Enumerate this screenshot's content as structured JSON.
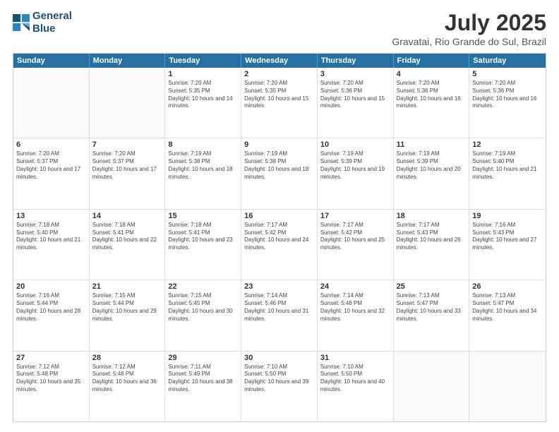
{
  "header": {
    "logo_line1": "General",
    "logo_line2": "Blue",
    "month_year": "July 2025",
    "location": "Gravatai, Rio Grande do Sul, Brazil"
  },
  "weekdays": [
    "Sunday",
    "Monday",
    "Tuesday",
    "Wednesday",
    "Thursday",
    "Friday",
    "Saturday"
  ],
  "weeks": [
    [
      {
        "day": "",
        "sunrise": "",
        "sunset": "",
        "daylight": ""
      },
      {
        "day": "",
        "sunrise": "",
        "sunset": "",
        "daylight": ""
      },
      {
        "day": "1",
        "sunrise": "Sunrise: 7:20 AM",
        "sunset": "Sunset: 5:35 PM",
        "daylight": "Daylight: 10 hours and 14 minutes."
      },
      {
        "day": "2",
        "sunrise": "Sunrise: 7:20 AM",
        "sunset": "Sunset: 5:35 PM",
        "daylight": "Daylight: 10 hours and 15 minutes."
      },
      {
        "day": "3",
        "sunrise": "Sunrise: 7:20 AM",
        "sunset": "Sunset: 5:36 PM",
        "daylight": "Daylight: 10 hours and 15 minutes."
      },
      {
        "day": "4",
        "sunrise": "Sunrise: 7:20 AM",
        "sunset": "Sunset: 5:36 PM",
        "daylight": "Daylight: 10 hours and 16 minutes."
      },
      {
        "day": "5",
        "sunrise": "Sunrise: 7:20 AM",
        "sunset": "Sunset: 5:36 PM",
        "daylight": "Daylight: 10 hours and 16 minutes."
      }
    ],
    [
      {
        "day": "6",
        "sunrise": "Sunrise: 7:20 AM",
        "sunset": "Sunset: 5:37 PM",
        "daylight": "Daylight: 10 hours and 17 minutes."
      },
      {
        "day": "7",
        "sunrise": "Sunrise: 7:20 AM",
        "sunset": "Sunset: 5:37 PM",
        "daylight": "Daylight: 10 hours and 17 minutes."
      },
      {
        "day": "8",
        "sunrise": "Sunrise: 7:19 AM",
        "sunset": "Sunset: 5:38 PM",
        "daylight": "Daylight: 10 hours and 18 minutes."
      },
      {
        "day": "9",
        "sunrise": "Sunrise: 7:19 AM",
        "sunset": "Sunset: 5:38 PM",
        "daylight": "Daylight: 10 hours and 18 minutes."
      },
      {
        "day": "10",
        "sunrise": "Sunrise: 7:19 AM",
        "sunset": "Sunset: 5:39 PM",
        "daylight": "Daylight: 10 hours and 19 minutes."
      },
      {
        "day": "11",
        "sunrise": "Sunrise: 7:19 AM",
        "sunset": "Sunset: 5:39 PM",
        "daylight": "Daylight: 10 hours and 20 minutes."
      },
      {
        "day": "12",
        "sunrise": "Sunrise: 7:19 AM",
        "sunset": "Sunset: 5:40 PM",
        "daylight": "Daylight: 10 hours and 21 minutes."
      }
    ],
    [
      {
        "day": "13",
        "sunrise": "Sunrise: 7:18 AM",
        "sunset": "Sunset: 5:40 PM",
        "daylight": "Daylight: 10 hours and 21 minutes."
      },
      {
        "day": "14",
        "sunrise": "Sunrise: 7:18 AM",
        "sunset": "Sunset: 5:41 PM",
        "daylight": "Daylight: 10 hours and 22 minutes."
      },
      {
        "day": "15",
        "sunrise": "Sunrise: 7:18 AM",
        "sunset": "Sunset: 5:41 PM",
        "daylight": "Daylight: 10 hours and 23 minutes."
      },
      {
        "day": "16",
        "sunrise": "Sunrise: 7:17 AM",
        "sunset": "Sunset: 5:42 PM",
        "daylight": "Daylight: 10 hours and 24 minutes."
      },
      {
        "day": "17",
        "sunrise": "Sunrise: 7:17 AM",
        "sunset": "Sunset: 5:42 PM",
        "daylight": "Daylight: 10 hours and 25 minutes."
      },
      {
        "day": "18",
        "sunrise": "Sunrise: 7:17 AM",
        "sunset": "Sunset: 5:43 PM",
        "daylight": "Daylight: 10 hours and 26 minutes."
      },
      {
        "day": "19",
        "sunrise": "Sunrise: 7:16 AM",
        "sunset": "Sunset: 5:43 PM",
        "daylight": "Daylight: 10 hours and 27 minutes."
      }
    ],
    [
      {
        "day": "20",
        "sunrise": "Sunrise: 7:16 AM",
        "sunset": "Sunset: 5:44 PM",
        "daylight": "Daylight: 10 hours and 28 minutes."
      },
      {
        "day": "21",
        "sunrise": "Sunrise: 7:15 AM",
        "sunset": "Sunset: 5:44 PM",
        "daylight": "Daylight: 10 hours and 29 minutes."
      },
      {
        "day": "22",
        "sunrise": "Sunrise: 7:15 AM",
        "sunset": "Sunset: 5:45 PM",
        "daylight": "Daylight: 10 hours and 30 minutes."
      },
      {
        "day": "23",
        "sunrise": "Sunrise: 7:14 AM",
        "sunset": "Sunset: 5:46 PM",
        "daylight": "Daylight: 10 hours and 31 minutes."
      },
      {
        "day": "24",
        "sunrise": "Sunrise: 7:14 AM",
        "sunset": "Sunset: 5:46 PM",
        "daylight": "Daylight: 10 hours and 32 minutes."
      },
      {
        "day": "25",
        "sunrise": "Sunrise: 7:13 AM",
        "sunset": "Sunset: 5:47 PM",
        "daylight": "Daylight: 10 hours and 33 minutes."
      },
      {
        "day": "26",
        "sunrise": "Sunrise: 7:13 AM",
        "sunset": "Sunset: 5:47 PM",
        "daylight": "Daylight: 10 hours and 34 minutes."
      }
    ],
    [
      {
        "day": "27",
        "sunrise": "Sunrise: 7:12 AM",
        "sunset": "Sunset: 5:48 PM",
        "daylight": "Daylight: 10 hours and 35 minutes."
      },
      {
        "day": "28",
        "sunrise": "Sunrise: 7:12 AM",
        "sunset": "Sunset: 5:48 PM",
        "daylight": "Daylight: 10 hours and 36 minutes."
      },
      {
        "day": "29",
        "sunrise": "Sunrise: 7:11 AM",
        "sunset": "Sunset: 5:49 PM",
        "daylight": "Daylight: 10 hours and 38 minutes."
      },
      {
        "day": "30",
        "sunrise": "Sunrise: 7:10 AM",
        "sunset": "Sunset: 5:50 PM",
        "daylight": "Daylight: 10 hours and 39 minutes."
      },
      {
        "day": "31",
        "sunrise": "Sunrise: 7:10 AM",
        "sunset": "Sunset: 5:50 PM",
        "daylight": "Daylight: 10 hours and 40 minutes."
      },
      {
        "day": "",
        "sunrise": "",
        "sunset": "",
        "daylight": ""
      },
      {
        "day": "",
        "sunrise": "",
        "sunset": "",
        "daylight": ""
      }
    ]
  ]
}
